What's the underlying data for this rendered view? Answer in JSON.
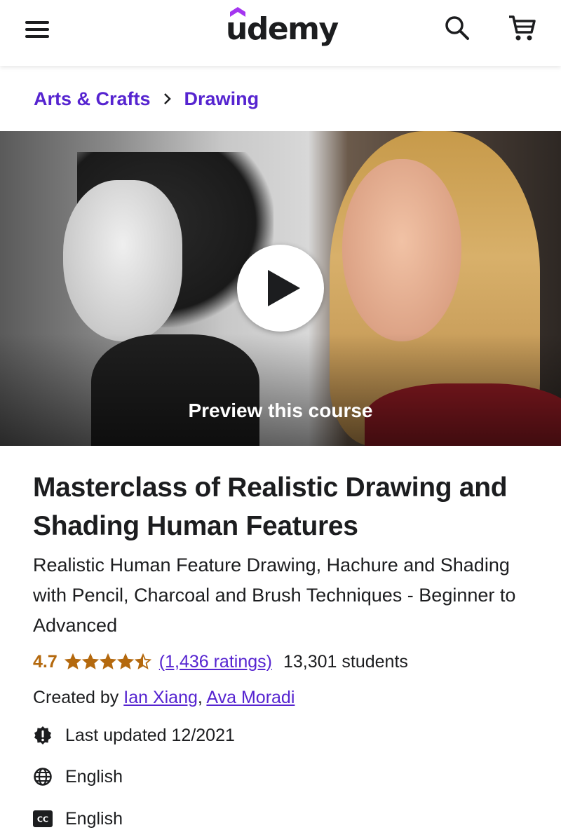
{
  "header": {
    "logo_text": "udemy",
    "menu_icon": "hamburger-menu-icon",
    "search_icon": "search-icon",
    "cart_icon": "cart-icon"
  },
  "breadcrumb": {
    "items": [
      "Arts & Crafts",
      "Drawing"
    ],
    "separator_icon": "chevron-right-icon"
  },
  "preview": {
    "label": "Preview this course",
    "play_icon": "play-icon"
  },
  "course": {
    "title": "Masterclass of Realistic Drawing and Shading Human Features",
    "subtitle": "Realistic Human Feature Drawing, Hachure and Shading with Pencil, Charcoal and Brush Techniques - Beginner to Advanced",
    "rating": "4.7",
    "stars": 4.7,
    "ratings_count": "(1,436 ratings)",
    "students": "13,301 students",
    "created_by_label": "Created by",
    "creators": [
      "Ian Xiang",
      "Ava Moradi"
    ],
    "creator_separator": ", ",
    "last_updated": "Last updated 12/2021",
    "language": "English",
    "captions": "English"
  },
  "colors": {
    "brand_purple": "#5624d0",
    "rating_orange": "#b4690e",
    "text": "#1c1d1f"
  }
}
